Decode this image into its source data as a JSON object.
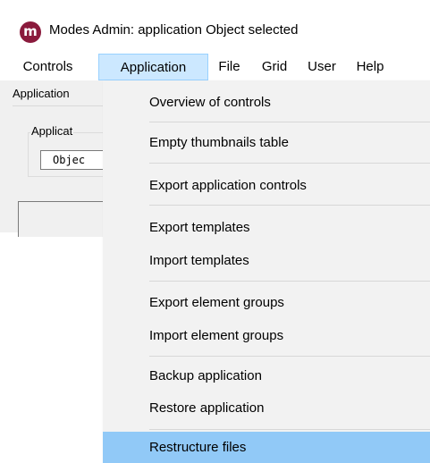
{
  "window": {
    "title": "Modes Admin: application Object selected",
    "logo_letter": "m"
  },
  "menubar": {
    "items": [
      {
        "label": "Controls"
      },
      {
        "label": "Application"
      },
      {
        "label": "File"
      },
      {
        "label": "Grid"
      },
      {
        "label": "User"
      },
      {
        "label": "Help"
      }
    ],
    "active": "Application"
  },
  "client": {
    "tab_label": "Application",
    "group_label": "Applicat",
    "field_value": "Objec"
  },
  "dropdown": {
    "items": [
      {
        "label": "Overview of controls"
      },
      {
        "label": "Empty thumbnails table"
      },
      {
        "label": "Export application controls"
      },
      {
        "label": "Export templates"
      },
      {
        "label": "Import templates"
      },
      {
        "label": "Export element groups"
      },
      {
        "label": "Import element groups"
      },
      {
        "label": "Backup application"
      },
      {
        "label": "Restore application"
      },
      {
        "label": "Restructure files"
      }
    ],
    "highlighted": "Restructure files"
  },
  "colors": {
    "menu_active_bg": "#cce8ff",
    "dropdown_bg": "#f2f2f2",
    "highlight_bg": "#91c9f7",
    "logo_bg": "#8a1a3c"
  }
}
